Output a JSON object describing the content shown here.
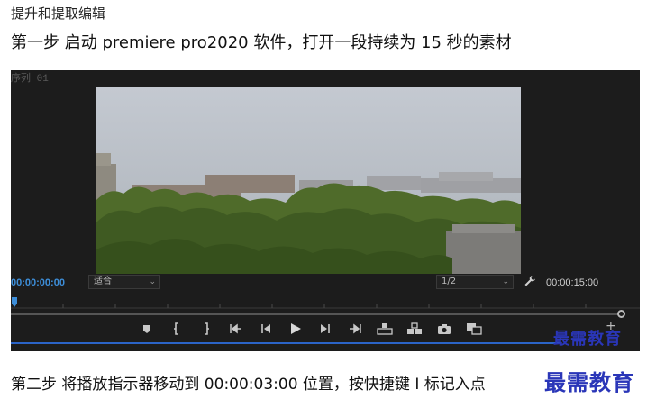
{
  "document": {
    "title": "提升和提取编辑",
    "step1": "第一步  启动 premiere pro2020 软件，打开一段持续为 15 秒的素材",
    "step2": "第二步  将播放指示器移动到 00:00:03:00 位置，按快捷键 I 标记入点"
  },
  "player": {
    "sequence_tab": "序列 01",
    "current_timecode": "00:00:00:00",
    "fit_label": "适合",
    "resolution_label": "1/2",
    "duration_timecode": "00:00:15:00",
    "icons": {
      "marker": "marker-icon",
      "mark_in": "mark-in-icon",
      "mark_out": "mark-out-icon",
      "go_to_in": "go-to-in-icon",
      "step_back": "step-back-icon",
      "play": "play-icon",
      "step_forward": "step-forward-icon",
      "go_to_out": "go-to-out-icon",
      "lift": "lift-icon",
      "extract": "extract-icon",
      "export_frame": "camera-icon",
      "comparison_view": "comparison-view-icon",
      "settings": "wrench-icon",
      "add_button": "plus-icon"
    },
    "colors": {
      "panel_bg": "#1c1c1c",
      "timecode_accent": "#3d8ed9",
      "playhead_line": "#2b64c8"
    }
  },
  "watermark": {
    "small": "最需教育",
    "large": "最需教育",
    "color": "#2a36b8"
  }
}
